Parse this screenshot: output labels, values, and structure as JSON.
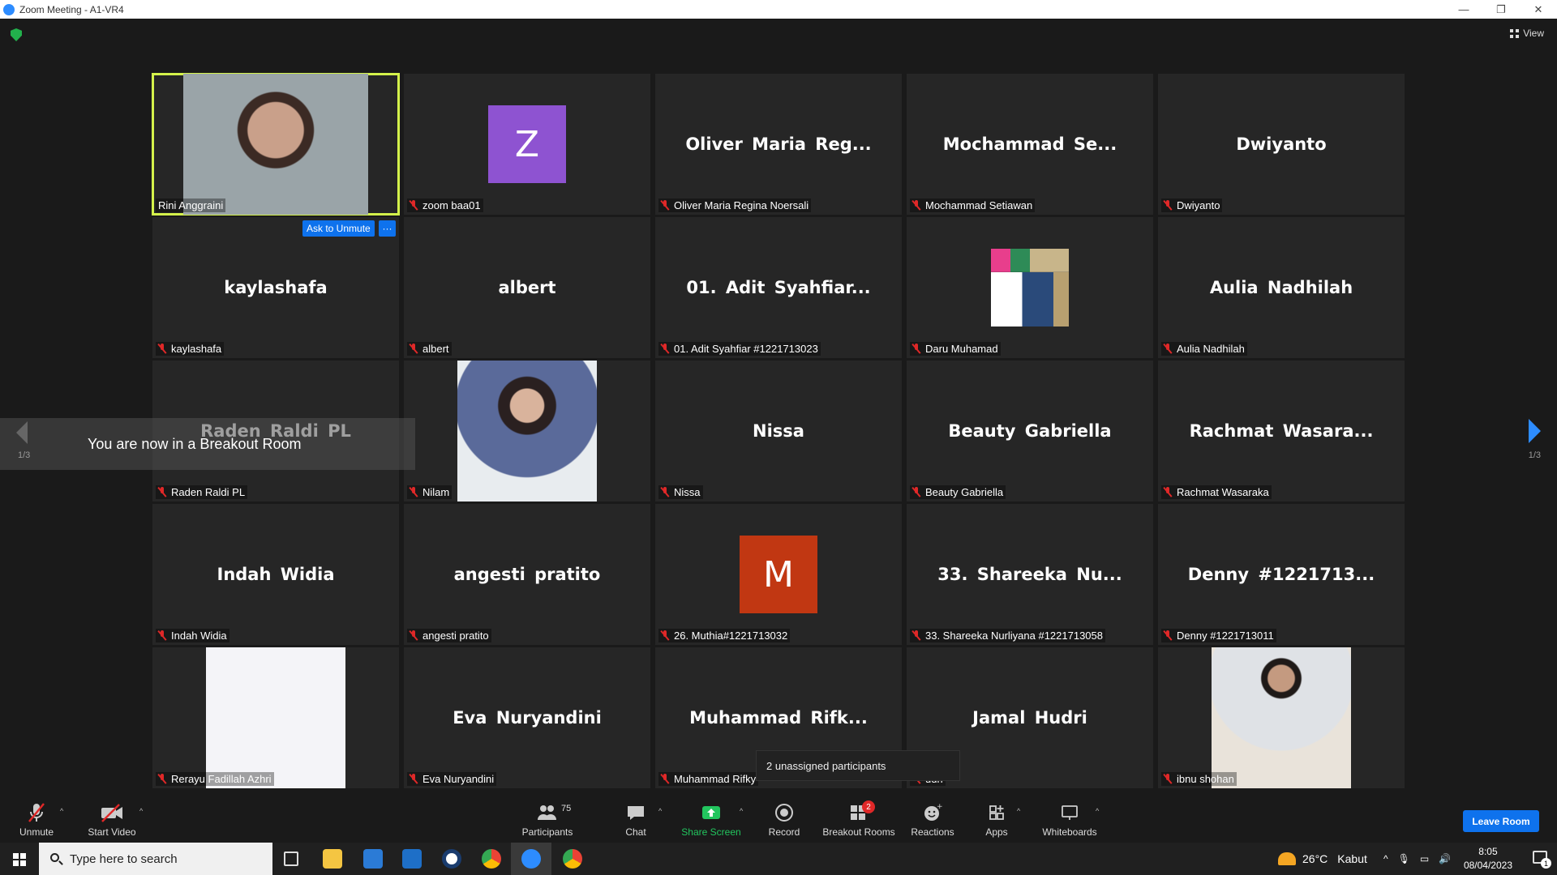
{
  "window": {
    "title": "Zoom Meeting - A1-VR4",
    "controls": [
      "—",
      "❐",
      "✕"
    ]
  },
  "header": {
    "view_label": "View"
  },
  "tiles": [
    {
      "name": "",
      "label": "Rini Anggraini",
      "kind": "photo",
      "active": true
    },
    {
      "name": "",
      "label": "zoom baa01",
      "kind": "avatar",
      "letter": "Z",
      "color": "#8e53d1"
    },
    {
      "name": "Oliver Maria Reg...",
      "label": "Oliver Maria Regina Noersali"
    },
    {
      "name": "Mochammad Se...",
      "label": "Mochammad Setiawan"
    },
    {
      "name": "Dwiyanto",
      "label": "Dwiyanto"
    },
    {
      "name": "kaylashafa",
      "label": "kaylashafa"
    },
    {
      "name": "albert",
      "label": "albert"
    },
    {
      "name": "01. Adit Syahfiar...",
      "label": "01. Adit Syahfiar #1221713023"
    },
    {
      "name": "",
      "label": "Daru Muhamad",
      "kind": "collage"
    },
    {
      "name": "Aulia Nadhilah",
      "label": "Aulia Nadhilah"
    },
    {
      "name": "Raden Raldi PL",
      "label": "Raden Raldi PL"
    },
    {
      "name": "",
      "label": "Nilam",
      "kind": "photo"
    },
    {
      "name": "Nissa",
      "label": "Nissa"
    },
    {
      "name": "Beauty Gabriella",
      "label": "Beauty Gabriella"
    },
    {
      "name": "Rachmat Wasara...",
      "label": "Rachmat Wasaraka"
    },
    {
      "name": "Indah Widia",
      "label": "Indah Widia"
    },
    {
      "name": "angesti pratito",
      "label": "angesti pratito"
    },
    {
      "name": "",
      "label": "26. Muthia#1221713032",
      "kind": "avatar",
      "letter": "M",
      "color": "#c13712"
    },
    {
      "name": "33. Shareeka Nu...",
      "label": "33. Shareeka Nurliyana #1221713058"
    },
    {
      "name": "Denny #1221713...",
      "label": "Denny #1221713011"
    },
    {
      "name": "",
      "label": "Rerayu Fadillah Azhri",
      "kind": "blank"
    },
    {
      "name": "Eva Nuryandini",
      "label": "Eva Nuryandini"
    },
    {
      "name": "Muhammad Rifk...",
      "label": "Muhammad Rifky"
    },
    {
      "name": "Jamal Hudri",
      "label": "udri"
    },
    {
      "name": "",
      "label": "ibnu shohan",
      "kind": "photo"
    }
  ],
  "overlay": {
    "ask_to_unmute": "Ask to Unmute",
    "more": "···",
    "toast": "You are now in a Breakout Room",
    "page_left": "1/3",
    "page_right": "1/3",
    "popup": "2 unassigned participants"
  },
  "toolbar": {
    "unmute": "Unmute",
    "start_video": "Start Video",
    "participants": "Participants",
    "participants_count": "75",
    "chat": "Chat",
    "share_screen": "Share Screen",
    "record": "Record",
    "breakout_rooms": "Breakout Rooms",
    "breakout_badge": "2",
    "reactions": "Reactions",
    "apps": "Apps",
    "whiteboards": "Whiteboards",
    "leave_room": "Leave Room"
  },
  "taskbar": {
    "search_placeholder": "Type here to search",
    "weather_temp": "26°C",
    "weather_text": "Kabut",
    "time": "8:05",
    "date": "08/04/2023",
    "notifications": "1"
  },
  "colors": {
    "accent": "#0e72ed",
    "active_speaker": "#d4f24b",
    "mute": "#e02828",
    "share": "#22c55e"
  }
}
